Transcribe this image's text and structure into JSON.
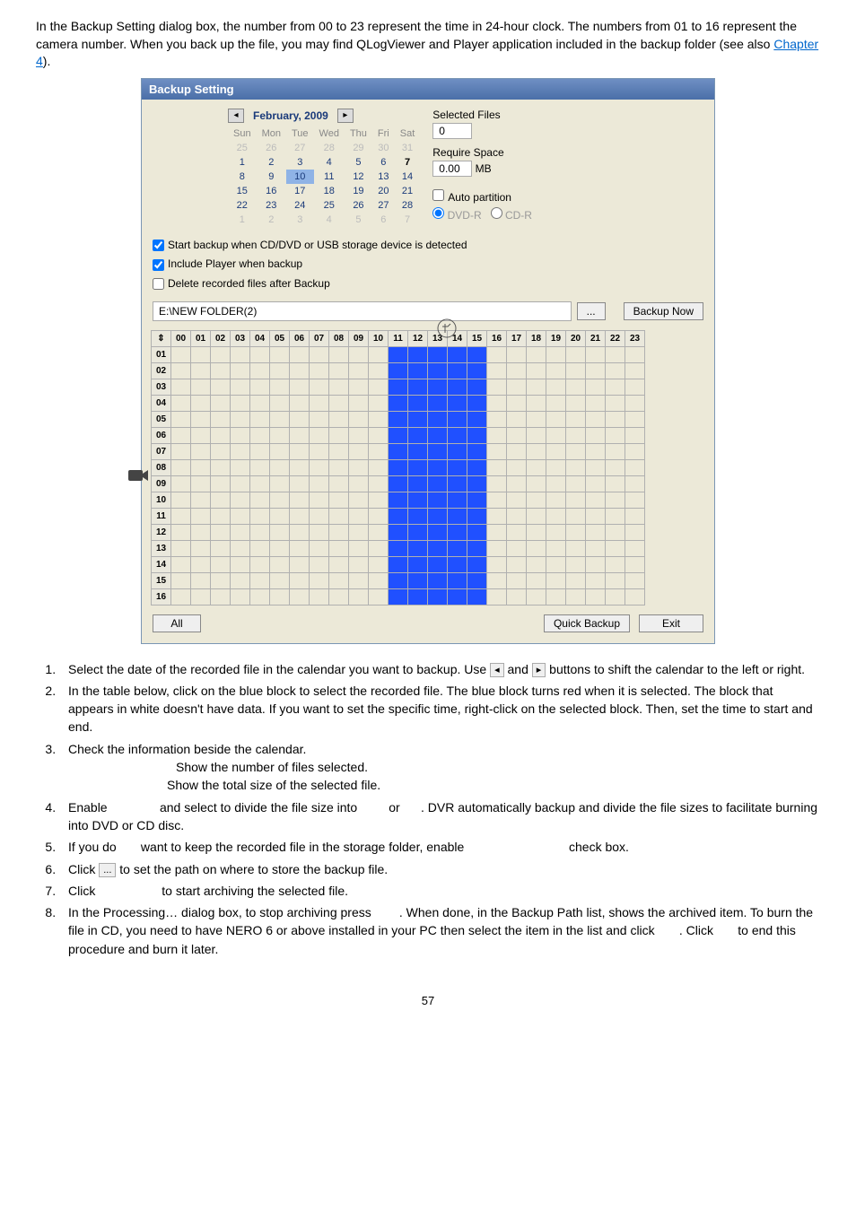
{
  "intro": "In the Backup Setting dialog box, the number from 00 to 23 represent the time in 24-hour clock. The numbers from 01 to 16 represent the camera number. When you back up the file, you may find QLogViewer and Player application included in the backup folder (see also ",
  "intro_link": "Chapter 4",
  "intro_tail": ").",
  "dialog": {
    "title": "Backup Setting",
    "calendar": {
      "month": "February, 2009",
      "dow": [
        "Sun",
        "Mon",
        "Tue",
        "Wed",
        "Thu",
        "Fri",
        "Sat"
      ],
      "rows": [
        [
          {
            "v": "25",
            "dim": true
          },
          {
            "v": "26",
            "dim": true
          },
          {
            "v": "27",
            "dim": true
          },
          {
            "v": "28",
            "dim": true
          },
          {
            "v": "29",
            "dim": true
          },
          {
            "v": "30",
            "dim": true
          },
          {
            "v": "31",
            "dim": true
          }
        ],
        [
          {
            "v": "1"
          },
          {
            "v": "2"
          },
          {
            "v": "3"
          },
          {
            "v": "4"
          },
          {
            "v": "5"
          },
          {
            "v": "6"
          },
          {
            "v": "7",
            "today": true
          }
        ],
        [
          {
            "v": "8"
          },
          {
            "v": "9"
          },
          {
            "v": "10",
            "sel": true
          },
          {
            "v": "11"
          },
          {
            "v": "12"
          },
          {
            "v": "13"
          },
          {
            "v": "14"
          }
        ],
        [
          {
            "v": "15"
          },
          {
            "v": "16"
          },
          {
            "v": "17"
          },
          {
            "v": "18"
          },
          {
            "v": "19"
          },
          {
            "v": "20"
          },
          {
            "v": "21"
          }
        ],
        [
          {
            "v": "22"
          },
          {
            "v": "23"
          },
          {
            "v": "24"
          },
          {
            "v": "25"
          },
          {
            "v": "26"
          },
          {
            "v": "27"
          },
          {
            "v": "28"
          }
        ],
        [
          {
            "v": "1",
            "dim": true
          },
          {
            "v": "2",
            "dim": true
          },
          {
            "v": "3",
            "dim": true
          },
          {
            "v": "4",
            "dim": true
          },
          {
            "v": "5",
            "dim": true
          },
          {
            "v": "6",
            "dim": true
          },
          {
            "v": "7",
            "dim": true
          }
        ]
      ]
    },
    "selected_files_label": "Selected Files",
    "selected_files_value": "0",
    "require_space_label": "Require Space",
    "require_space_value": "0.00",
    "require_space_unit": "MB",
    "auto_partition": "Auto partition",
    "dvd_r": "DVD-R",
    "cd_r": "CD-R",
    "start_backup": "Start backup when CD/DVD or USB storage device is detected",
    "include_player": "Include Player when backup",
    "delete_recorded": "Delete recorded files after Backup",
    "path_value": "E:\\NEW FOLDER(2)",
    "browse_btn": "...",
    "backup_now": "Backup Now",
    "hours": [
      "00",
      "01",
      "02",
      "03",
      "04",
      "05",
      "06",
      "07",
      "08",
      "09",
      "10",
      "11",
      "12",
      "13",
      "14",
      "15",
      "16",
      "17",
      "18",
      "19",
      "20",
      "21",
      "22",
      "23"
    ],
    "cams": [
      "01",
      "02",
      "03",
      "04",
      "05",
      "06",
      "07",
      "08",
      "09",
      "10",
      "11",
      "12",
      "13",
      "14",
      "15",
      "16"
    ],
    "blue_cols": [
      11,
      12,
      13,
      14,
      15
    ],
    "arrows": "⇕",
    "all_btn": "All",
    "quick_backup": "Quick Backup",
    "exit": "Exit"
  },
  "steps": [
    {
      "n": "1.",
      "t1": "Select the date of the recorded file in the calendar you want to backup. Use ",
      "btn1": "◂",
      "t2": " and ",
      "btn2": "▸",
      "t3": " buttons to shift the calendar to the left or right."
    },
    {
      "n": "2.",
      "t": "In the table below, click on the blue block to select the recorded file. The blue block turns red when it is selected. The block that appears in white doesn't have data. If you want to set the specific time, right-click on the selected block. Then, set the time to start and end."
    },
    {
      "n": "3.",
      "t": "Check the information beside the calendar.",
      "sub1": "Show the number of files selected.",
      "sub2": "Show the total size of the selected file."
    },
    {
      "n": "4.",
      "t1": "Enable ",
      "t2": " and select to divide the file size into ",
      "t3": " or ",
      "t4": ". DVR automatically backup and divide the file sizes to facilitate burning into DVD or CD disc."
    },
    {
      "n": "5.",
      "t1": "If you do ",
      "t2": " want to keep the recorded file in the storage folder, enable ",
      "t3": " check box."
    },
    {
      "n": "6.",
      "t1": "Click ",
      "btn": "...",
      "t2": " to set the path on where to store the backup file."
    },
    {
      "n": "7.",
      "t1": "Click ",
      "t2": " to start archiving the selected file."
    },
    {
      "n": "8.",
      "t1": "In the Processing… dialog box, to stop archiving press ",
      "t2": ". When done, in the Backup Path list, shows the archived item. To burn the file in CD, you need to have NERO 6 or above installed in your PC then select the item in the list and click ",
      "t3": ". Click ",
      "t4": " to end this procedure and burn it later."
    }
  ],
  "page_num": "57"
}
